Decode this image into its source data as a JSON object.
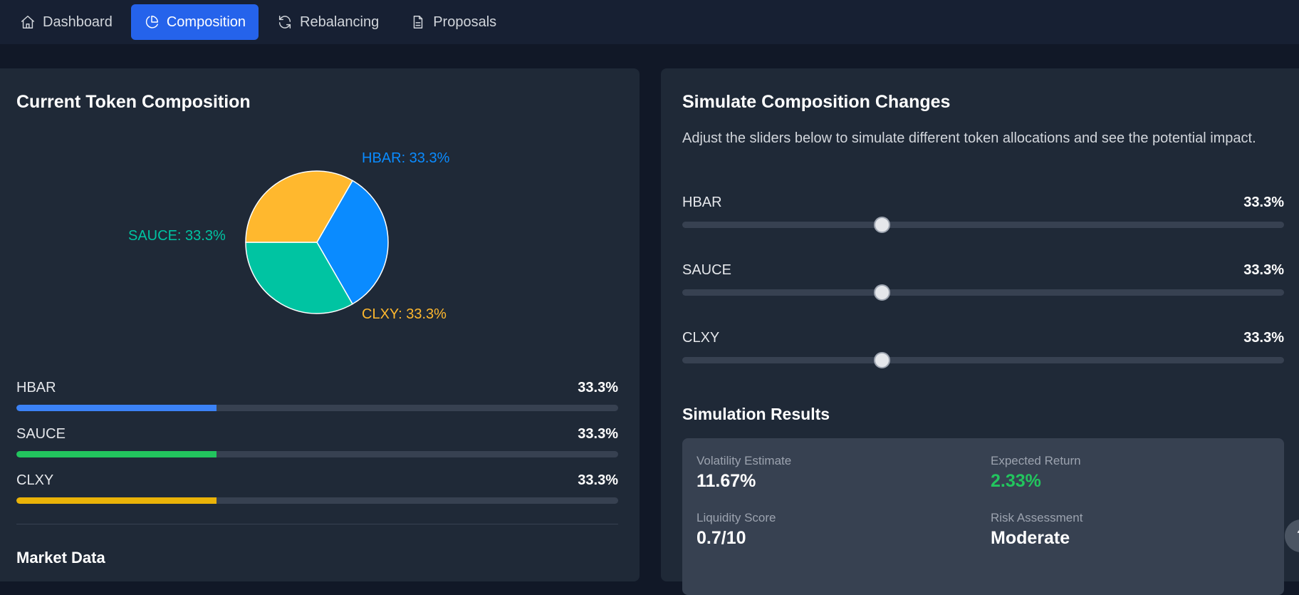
{
  "nav": {
    "tabs": [
      {
        "label": "Dashboard",
        "icon": "home-icon"
      },
      {
        "label": "Composition",
        "icon": "pie-chart-icon",
        "active": true
      },
      {
        "label": "Rebalancing",
        "icon": "refresh-icon"
      },
      {
        "label": "Proposals",
        "icon": "document-icon"
      }
    ]
  },
  "composition": {
    "title": "Current Token Composition",
    "pie_labels": {
      "hbar": "HBAR: 33.3%",
      "sauce": "SAUCE: 33.3%",
      "clxy": "CLXY: 33.3%"
    },
    "bars": [
      {
        "name": "HBAR",
        "value": "33.3%",
        "fraction": 0.333,
        "color": "#3b82f6"
      },
      {
        "name": "SAUCE",
        "value": "33.3%",
        "fraction": 0.333,
        "color": "#22c55e"
      },
      {
        "name": "CLXY",
        "value": "33.3%",
        "fraction": 0.333,
        "color": "#eab308"
      }
    ],
    "market_title": "Market Data"
  },
  "simulate": {
    "title": "Simulate Composition Changes",
    "description": "Adjust the sliders below to simulate different token allocations and see the potential impact.",
    "sliders": [
      {
        "name": "HBAR",
        "value": "33.3%",
        "fraction": 0.333
      },
      {
        "name": "SAUCE",
        "value": "33.3%",
        "fraction": 0.333
      },
      {
        "name": "CLXY",
        "value": "33.3%",
        "fraction": 0.333
      }
    ],
    "results_title": "Simulation Results",
    "results": {
      "volatility_label": "Volatility Estimate",
      "volatility_value": "11.67%",
      "return_label": "Expected Return",
      "return_value": "2.33%",
      "liquidity_label": "Liquidity Score",
      "liquidity_value": "0.7/10",
      "risk_label": "Risk Assessment",
      "risk_value": "Moderate"
    }
  },
  "colors": {
    "accent": "#2563eb",
    "hbar": "#0a8bff",
    "sauce": "#00c4a2",
    "clxy": "#ffb82e",
    "positive": "#22c55e"
  },
  "chart_data": {
    "type": "pie",
    "categories": [
      "HBAR",
      "SAUCE",
      "CLXY"
    ],
    "values": [
      33.3,
      33.3,
      33.3
    ],
    "colors": [
      "#0a8bff",
      "#00c4a2",
      "#ffb82e"
    ]
  },
  "help": {
    "icon": "help-icon"
  }
}
